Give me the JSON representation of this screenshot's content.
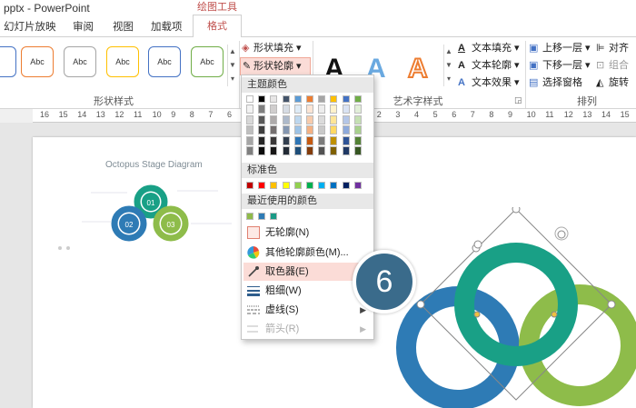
{
  "window": {
    "title": "pptx - PowerPoint",
    "contextual_tab_group": "绘图工具"
  },
  "tabs": [
    "幻灯片放映",
    "审阅",
    "视图",
    "加载项",
    "格式"
  ],
  "ribbon": {
    "style_button_label": "Abc",
    "shape_fill": "形状填充",
    "shape_outline": "形状轮廓",
    "text_fill": "文本填充",
    "text_outline": "文本轮廓",
    "text_effect": "文本效果",
    "bring_forward": "上移一层",
    "send_backward": "下移一层",
    "selection_pane": "选择窗格",
    "align": "对齐",
    "group": "组合",
    "rotate": "旋转",
    "group_shape_styles": "形状样式",
    "group_wordart": "艺术字样式",
    "group_arrange": "排列"
  },
  "ruler": {
    "ticks": [
      "16",
      "15",
      "14",
      "13",
      "12",
      "11",
      "10",
      "9",
      "8",
      "7",
      "6",
      "5",
      "4",
      "3",
      "2",
      "1",
      "0",
      "1",
      "2",
      "3",
      "4",
      "5",
      "6",
      "7",
      "8",
      "9",
      "10",
      "11",
      "12",
      "13",
      "14",
      "15"
    ]
  },
  "menu": {
    "theme_colors_header": "主题颜色",
    "standard_colors_header": "标准色",
    "recent_colors_header": "最近使用的颜色",
    "no_outline": "无轮廓(N)",
    "more_colors": "其他轮廓颜色(M)...",
    "eyedropper": "取色器(E)",
    "weight": "粗细(W)",
    "dashes": "虚线(S)",
    "arrows": "箭头(R)",
    "theme_colors": [
      [
        "#ffffff",
        "#000000",
        "#e7e6e6",
        "#44546a",
        "#5b9bd5",
        "#ed7d31",
        "#a5a5a5",
        "#ffc000",
        "#4472c4",
        "#70ad47"
      ],
      [
        "#f2f2f2",
        "#7f7f7f",
        "#d0cece",
        "#d6dce4",
        "#deebf6",
        "#fbe5d5",
        "#ededed",
        "#fff2cc",
        "#dae3f3",
        "#e2efd9"
      ],
      [
        "#d8d8d8",
        "#595959",
        "#aeabab",
        "#adb9ca",
        "#bdd7ee",
        "#f7cbac",
        "#dbdbdb",
        "#fee599",
        "#b4c6e7",
        "#c5e0b3"
      ],
      [
        "#bfbfbf",
        "#3f3f3f",
        "#757070",
        "#8496b0",
        "#9dc3e6",
        "#f4b183",
        "#c9c9c9",
        "#ffd965",
        "#8eaadb",
        "#a8d08d"
      ],
      [
        "#a5a5a5",
        "#262626",
        "#3a3838",
        "#333f4f",
        "#2e75b5",
        "#c55a11",
        "#7b7b7b",
        "#bf9000",
        "#2f5496",
        "#538135"
      ],
      [
        "#7f7f7f",
        "#0c0c0c",
        "#171616",
        "#222a35",
        "#1e4e79",
        "#833c0b",
        "#525252",
        "#7f6000",
        "#1f3864",
        "#375623"
      ]
    ],
    "standard_colors": [
      "#c00000",
      "#ff0000",
      "#ffc000",
      "#ffff00",
      "#92d050",
      "#00b050",
      "#00b0f0",
      "#0070c0",
      "#002060",
      "#7030a0"
    ],
    "recent_colors": [
      "#8fba4a",
      "#2e7bb5",
      "#1a9a86"
    ]
  },
  "slide": {
    "thumbnail_title": "Octopus Stage Diagram",
    "thumbnail_rings": [
      "01",
      "02",
      "03"
    ],
    "ring_colors": {
      "teal": "#19a086",
      "blue": "#2e7bb5",
      "green": "#8ebc4a"
    }
  },
  "step_badge": "6"
}
